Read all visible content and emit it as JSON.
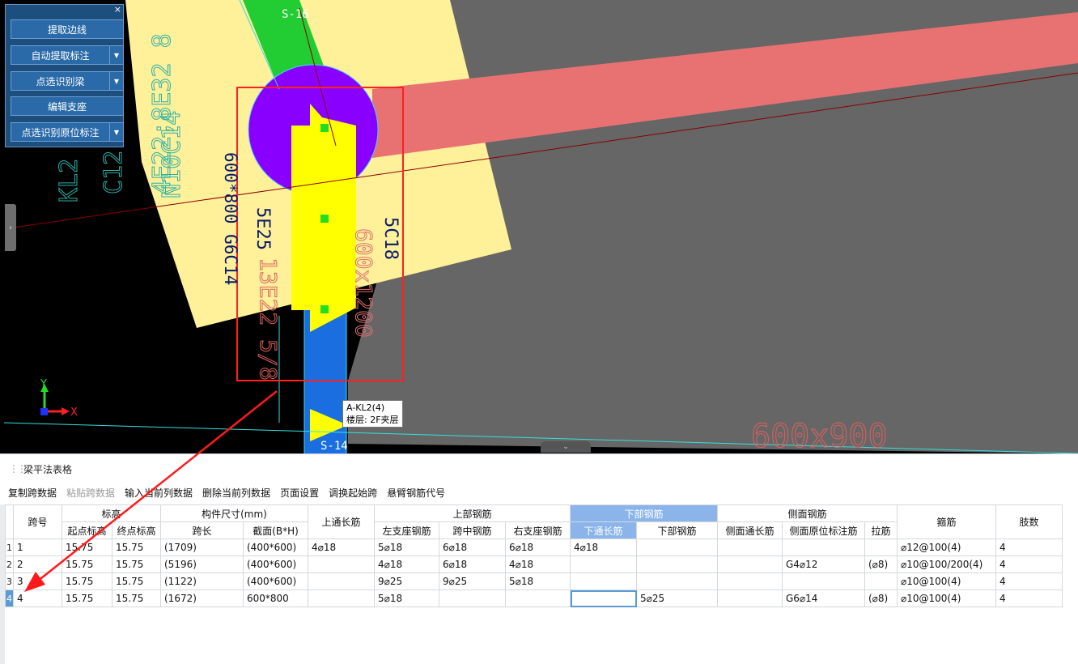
{
  "panel": {
    "close": "×",
    "buttons": [
      {
        "label": "提取边线",
        "dropdown": false
      },
      {
        "label": "自动提取标注",
        "dropdown": true
      },
      {
        "label": "点选识别梁",
        "dropdown": true
      },
      {
        "label": "编辑支座",
        "dropdown": false
      },
      {
        "label": "点选识别原位标注",
        "dropdown": true
      }
    ]
  },
  "canvas": {
    "axis_labels": {
      "top": "S-16",
      "bottom": "S-14"
    },
    "axis_y": "Y",
    "axis_x": "X",
    "annotations": {
      "a1": "5C18",
      "a2": "5E25",
      "a3": "600*800 G6C14",
      "a4": "13E22 5/8",
      "a5": "600x1200",
      "a6": "600x900",
      "a7": "N10C14",
      "a8": "4E22;8E32 8",
      "a9": "C12",
      "a10": "KL2"
    },
    "tooltip": {
      "line1": "A-KL2(4)",
      "line2": "楼层: 2F夹层"
    },
    "left_handle": "‹",
    "bottom_handle": "⌄"
  },
  "table_panel": {
    "title": "梁平法表格",
    "toolbar": [
      {
        "label": "复制跨数据",
        "enabled": true
      },
      {
        "label": "粘贴跨数据",
        "enabled": false
      },
      {
        "label": "输入当前列数据",
        "enabled": true
      },
      {
        "label": "删除当前列数据",
        "enabled": true
      },
      {
        "label": "页面设置",
        "enabled": true
      },
      {
        "label": "调换起始跨",
        "enabled": true
      },
      {
        "label": "悬臂钢筋代号",
        "enabled": true
      }
    ],
    "headers": {
      "span_no": "跨号",
      "elevation": "标高",
      "start_elev": "起点标高",
      "end_elev": "终点标高",
      "size": "构件尺寸(mm)",
      "span_len": "跨长",
      "section": "截面(B*H)",
      "top_long": "上通长筋",
      "top_bars": "上部钢筋",
      "left_seat": "左支座钢筋",
      "mid_span": "跨中钢筋",
      "right_seat": "右支座钢筋",
      "bottom_bars": "下部钢筋",
      "bottom_long": "下通长筋",
      "bottom_bar": "下部钢筋",
      "side_bars": "侧面钢筋",
      "side_long": "侧面通长筋",
      "side_orig": "侧面原位标注筋",
      "tie": "拉筋",
      "stirrup": "箍筋",
      "legs": "肢数"
    },
    "rows": [
      {
        "rn": "1",
        "span": "1",
        "start": "15.75",
        "end": "15.75",
        "len": "(1709)",
        "sec": "(400*600)",
        "top_long": "4⌀18",
        "left": "5⌀18",
        "mid": "6⌀18",
        "right": "6⌀18",
        "bot_long": "4⌀18",
        "bot": "",
        "side_long": "",
        "side_orig": "",
        "tie": "",
        "stirrup": "⌀12@100(4)",
        "legs": "4"
      },
      {
        "rn": "2",
        "span": "2",
        "start": "15.75",
        "end": "15.75",
        "len": "(5196)",
        "sec": "(400*600)",
        "top_long": "",
        "left": "4⌀18",
        "mid": "6⌀18",
        "right": "4⌀18",
        "bot_long": "",
        "bot": "",
        "side_long": "",
        "side_orig": "G4⌀12",
        "tie": "(⌀8)",
        "stirrup": "⌀10@100/200(4)",
        "legs": "4"
      },
      {
        "rn": "3",
        "span": "3",
        "start": "15.75",
        "end": "15.75",
        "len": "(1122)",
        "sec": "(400*600)",
        "top_long": "",
        "left": "9⌀25",
        "mid": "9⌀25",
        "right": "5⌀18",
        "bot_long": "",
        "bot": "",
        "side_long": "",
        "side_orig": "",
        "tie": "",
        "stirrup": "⌀10@100(4)",
        "legs": "4"
      },
      {
        "rn": "4",
        "span": "4",
        "start": "15.75",
        "end": "15.75",
        "len": "(1672)",
        "sec": "600*800",
        "top_long": "",
        "left": "5⌀18",
        "mid": "",
        "right": "",
        "bot_long": "",
        "bot": "5⌀25",
        "side_long": "",
        "side_orig": "G6⌀14",
        "tie": "(⌀8)",
        "stirrup": "⌀10@100(4)",
        "legs": "4"
      }
    ]
  }
}
